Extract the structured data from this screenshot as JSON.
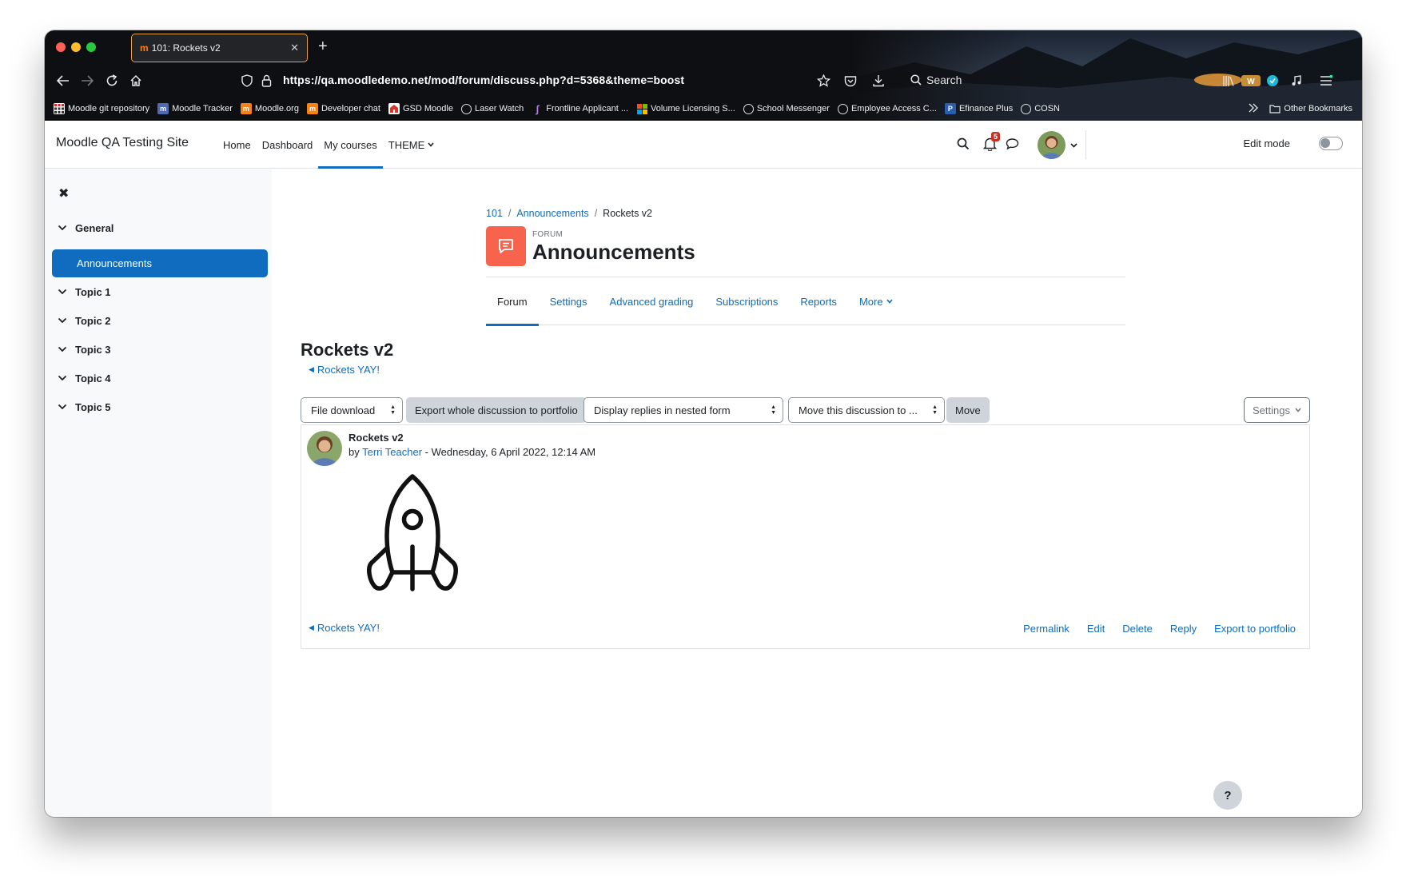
{
  "browser": {
    "tab_favicon": "m",
    "tab_title": "101: Rockets v2",
    "tab_close": "✕",
    "new_tab": "+",
    "url": "https://qa.moodledemo.net/mod/forum/discuss.php?d=5368&theme=boost",
    "search_label": "Search",
    "bookmarks": [
      {
        "label": "Moodle git repository",
        "icon": "grid-icon",
        "color": "#e2202a"
      },
      {
        "label": "Moodle Tracker",
        "icon": "moodle-tracker-icon",
        "color": "#4d6ab4"
      },
      {
        "label": "Moodle.org",
        "icon": "moodle-icon",
        "color": "#f98012"
      },
      {
        "label": "Developer chat",
        "icon": "moodle-icon",
        "color": "#f98012"
      },
      {
        "label": "GSD Moodle",
        "icon": "school-icon",
        "color": "#d33a2c"
      },
      {
        "label": "Laser Watch",
        "icon": "globe-icon",
        "color": ""
      },
      {
        "label": "Frontline Applicant ...",
        "icon": "frontline-icon",
        "color": "#8e44ad"
      },
      {
        "label": "Volume Licensing S...",
        "icon": "microsoft-icon",
        "color": ""
      },
      {
        "label": "School Messenger",
        "icon": "globe-icon",
        "color": ""
      },
      {
        "label": "Employee Access C...",
        "icon": "globe-icon",
        "color": ""
      },
      {
        "label": "Efinance Plus",
        "icon": "p-icon",
        "color": "#2a5db0"
      },
      {
        "label": "COSN",
        "icon": "globe-icon",
        "color": ""
      }
    ],
    "other_bookmarks": "Other Bookmarks"
  },
  "moodle_nav": {
    "site_name": "Moodle QA Testing Site",
    "items": [
      {
        "label": "Home",
        "active": false
      },
      {
        "label": "Dashboard",
        "active": false
      },
      {
        "label": "My courses",
        "active": true
      },
      {
        "label": "THEME",
        "active": false
      }
    ],
    "notification_count": "5",
    "edit_mode_label": "Edit mode"
  },
  "course_index": {
    "close_icon": "✖",
    "sections": [
      {
        "label": "General"
      },
      {
        "label": "Topic 1"
      },
      {
        "label": "Topic 2"
      },
      {
        "label": "Topic 3"
      },
      {
        "label": "Topic 4"
      },
      {
        "label": "Topic 5"
      }
    ],
    "active_item": "Announcements"
  },
  "page": {
    "breadcrumb": [
      {
        "label": "101",
        "link": true
      },
      {
        "label": "Announcements",
        "link": true
      },
      {
        "label": "Rockets v2",
        "link": false
      }
    ],
    "activity_type": "FORUM",
    "activity_title": "Announcements",
    "secondary_nav": [
      {
        "label": "Forum",
        "active": true
      },
      {
        "label": "Settings",
        "active": false
      },
      {
        "label": "Advanced grading",
        "active": false
      },
      {
        "label": "Subscriptions",
        "active": false
      },
      {
        "label": "Reports",
        "active": false
      },
      {
        "label": "More",
        "active": false
      }
    ],
    "discussion_title": "Rockets v2",
    "prev_discussion": "Rockets YAY!",
    "next_discussion": "Rockets YAY!",
    "toolbar": {
      "portfolio_select": "File download",
      "export_button": "Export whole discussion to portfolio",
      "display_select": "Display replies in nested form",
      "move_select": "Move this discussion to ...",
      "move_button": "Move",
      "settings_button": "Settings"
    },
    "post": {
      "subject": "Rockets v2",
      "by_label": "by",
      "author": "Terri Teacher",
      "date": "- Wednesday, 6 April 2022, 12:14 AM",
      "actions": [
        "Permalink",
        "Edit",
        "Delete",
        "Reply",
        "Export to portfolio"
      ]
    },
    "help_button": "?"
  },
  "colors": {
    "brand_blue": "#0f6cbf",
    "forum_icon_bg": "#f7634d",
    "notification_badge": "#ca3120"
  }
}
